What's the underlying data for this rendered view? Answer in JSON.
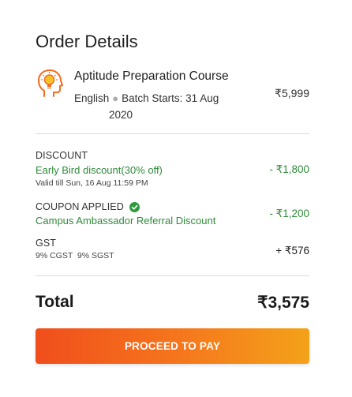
{
  "order": {
    "title": "Order Details",
    "course_icon": "head-lightbulb-icon",
    "course_name": "Aptitude Preparation Course",
    "language": "English",
    "batch_starts_part1": "Batch Starts: 31 Aug",
    "batch_starts_part2": "2020",
    "price": "₹5,999"
  },
  "discount": {
    "label": "DISCOUNT",
    "name": "Early Bird discount(30% off)",
    "validity": "Valid till Sun, 16 Aug 11:59 PM",
    "amount": "- ₹1,800"
  },
  "coupon": {
    "label": "COUPON APPLIED",
    "check_icon": "check-circle-icon",
    "name": "Campus Ambassador Referral Discount",
    "amount": "- ₹1,200"
  },
  "gst": {
    "label": "GST",
    "breakdown": "9% CGST  9% SGST",
    "amount": "+ ₹576"
  },
  "total": {
    "label": "Total",
    "value": "₹3,575"
  },
  "cta": {
    "label": "PROCEED TO PAY"
  },
  "colors": {
    "accent_start": "#f04e1c",
    "accent_end": "#f4a21a",
    "discount_green": "#2e8b3a",
    "icon_orange": "#f26b21"
  }
}
